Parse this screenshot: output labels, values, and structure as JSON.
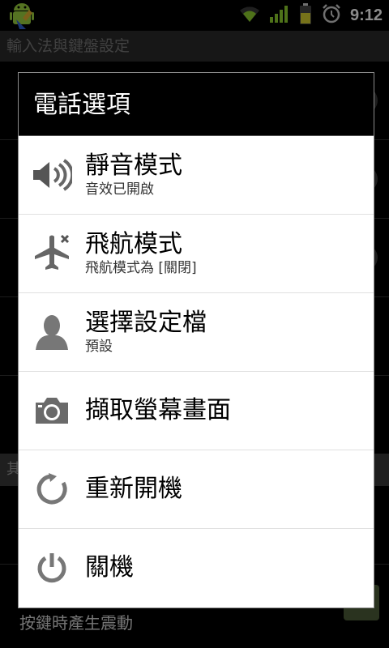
{
  "status_bar": {
    "time": "9:12",
    "icons": [
      "android-debug-icon",
      "wifi-icon",
      "signal-icon",
      "battery-icon",
      "alarm-icon"
    ]
  },
  "background": {
    "title": "輸入法與鍵盤設定",
    "section_label": "其",
    "last_item": "按鍵時產生震動"
  },
  "dialog": {
    "title": "電話選項",
    "items": [
      {
        "label": "靜音模式",
        "sub": "音效已開啟",
        "icon": "volume-icon"
      },
      {
        "label": "飛航模式",
        "sub": "飛航模式為 [關閉]",
        "icon": "airplane-icon"
      },
      {
        "label": "選擇設定檔",
        "sub": "預設",
        "icon": "profile-icon"
      },
      {
        "label": "擷取螢幕畫面",
        "icon": "camera-icon"
      },
      {
        "label": "重新開機",
        "icon": "reboot-icon"
      },
      {
        "label": "關機",
        "icon": "power-icon"
      }
    ]
  }
}
